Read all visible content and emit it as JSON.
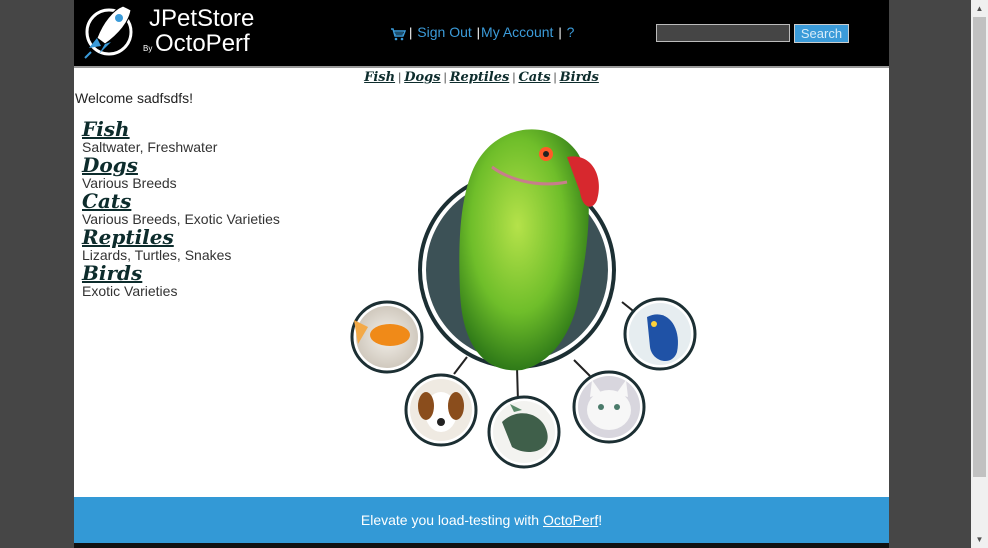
{
  "header": {
    "logo": {
      "brand_part1": "JPet",
      "brand_part2": "Store",
      "by": "By",
      "brand_line2": "OctoPerf"
    },
    "menu": {
      "sep": "|",
      "sign_out": "Sign Out",
      "my_account": "My Account",
      "help": "?"
    },
    "search": {
      "value": "",
      "button": "Search"
    }
  },
  "quick_links": [
    "Fish",
    "Dogs",
    "Reptiles",
    "Cats",
    "Birds"
  ],
  "quick_links_sep": "|",
  "welcome": {
    "prefix": "Welcome ",
    "username": "sadfsdfs",
    "suffix": "!"
  },
  "categories": [
    {
      "name": "Fish",
      "description": "Saltwater, Freshwater"
    },
    {
      "name": "Dogs",
      "description": "Various Breeds"
    },
    {
      "name": "Cats",
      "description": "Various Breeds, Exotic Varieties"
    },
    {
      "name": "Reptiles",
      "description": "Lizards, Turtles, Snakes"
    },
    {
      "name": "Birds",
      "description": "Exotic Varieties"
    }
  ],
  "footer": {
    "prefix": "Elevate you load-testing with ",
    "link": "OctoPerf",
    "suffix": "!"
  },
  "colors": {
    "accent": "#3399d6",
    "header_bg": "#000000",
    "category_text": "#0d2c2c"
  }
}
